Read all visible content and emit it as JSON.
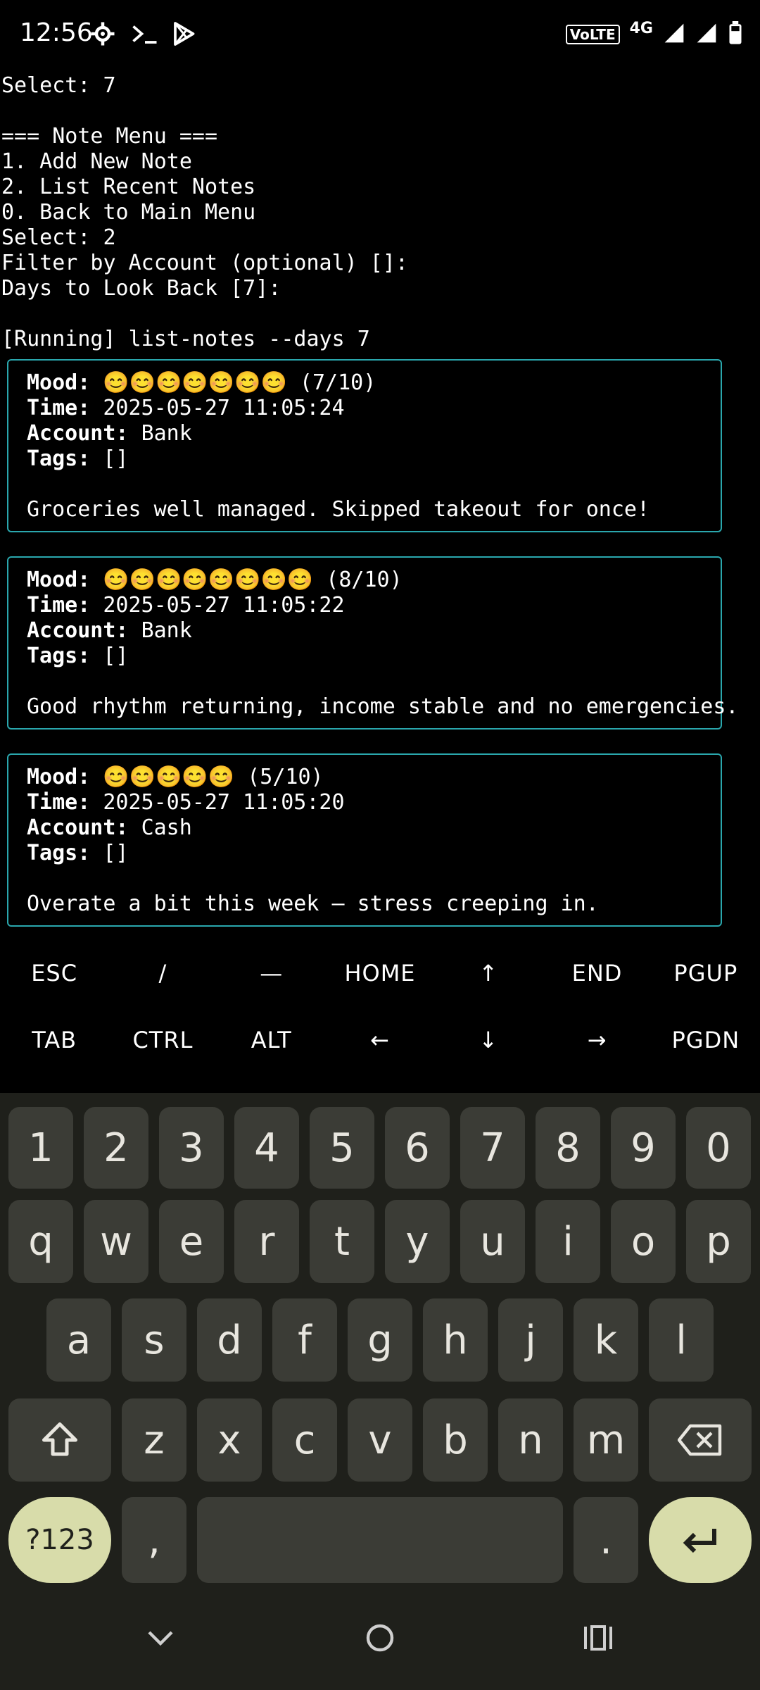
{
  "status_bar": {
    "time": "12:56",
    "volte": "VoLTE",
    "network": "4G"
  },
  "terminal": {
    "lines": [
      "Select: 7",
      "",
      "=== Note Menu ===",
      "1. Add New Note",
      "2. List Recent Notes",
      "0. Back to Main Menu",
      "Select: 2",
      "Filter by Account (optional) []:",
      "Days to Look Back [7]:",
      "",
      "[Running] list-notes --days 7"
    ],
    "notes": [
      {
        "mood_label": "Mood:",
        "mood_emoji": "😊😊😊😊😊😊😊",
        "mood_score": "(7/10)",
        "time_label": "Time:",
        "time": "2025-05-27 11:05:24",
        "account_label": "Account:",
        "account": "Bank",
        "tags_label": "Tags:",
        "tags": "[]",
        "text": "Groceries well managed. Skipped takeout for once!"
      },
      {
        "mood_label": "Mood:",
        "mood_emoji": "😊😊😊😊😊😊😊😊",
        "mood_score": "(8/10)",
        "time_label": "Time:",
        "time": "2025-05-27 11:05:22",
        "account_label": "Account:",
        "account": "Bank",
        "tags_label": "Tags:",
        "tags": "[]",
        "text": "Good rhythm returning, income stable and no emergencies."
      },
      {
        "mood_label": "Mood:",
        "mood_emoji": "😊😊😊😊😊",
        "mood_score": "(5/10)",
        "time_label": "Time:",
        "time": "2025-05-27 11:05:20",
        "account_label": "Account:",
        "account": "Cash",
        "tags_label": "Tags:",
        "tags": "[]",
        "text": "Overate a bit this week — stress creeping in."
      }
    ]
  },
  "extra_keys": {
    "row1": [
      "ESC",
      "/",
      "—",
      "HOME",
      "↑",
      "END",
      "PGUP"
    ],
    "row2": [
      "TAB",
      "CTRL",
      "ALT",
      "←",
      "↓",
      "→",
      "PGDN"
    ]
  },
  "keyboard": {
    "numbers": [
      "1",
      "2",
      "3",
      "4",
      "5",
      "6",
      "7",
      "8",
      "9",
      "0"
    ],
    "row_q": [
      "q",
      "w",
      "e",
      "r",
      "t",
      "y",
      "u",
      "i",
      "o",
      "p"
    ],
    "row_a": [
      "a",
      "s",
      "d",
      "f",
      "g",
      "h",
      "j",
      "k",
      "l"
    ],
    "row_z": [
      "z",
      "x",
      "c",
      "v",
      "b",
      "n",
      "m"
    ],
    "symbols_key": "?123",
    "comma_key": ",",
    "period_key": "."
  },
  "colors": {
    "card_border": "#2aa7ad",
    "keyboard_bg": "#1f201b",
    "key_bg": "#3b3c36",
    "accent_key_bg": "#d8dcaa"
  }
}
